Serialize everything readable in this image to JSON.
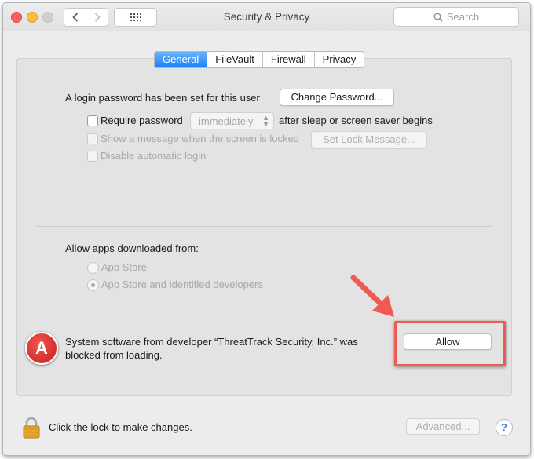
{
  "window": {
    "title": "Security & Privacy"
  },
  "toolbar": {
    "search_placeholder": "Search",
    "back_icon": "chevron-left-icon",
    "forward_icon": "chevron-right-icon",
    "grid_icon": "grid-icon"
  },
  "tabs": [
    {
      "label": "General",
      "active": true
    },
    {
      "label": "FileVault",
      "active": false
    },
    {
      "label": "Firewall",
      "active": false
    },
    {
      "label": "Privacy",
      "active": false
    }
  ],
  "general": {
    "login_password_text": "A login password has been set for this user",
    "change_password_button": "Change Password...",
    "require_password_label": "Require password",
    "require_password_value": "immediately",
    "after_sleep_text": "after sleep or screen saver begins",
    "show_message_label": "Show a message when the screen is locked",
    "set_lock_message_button": "Set Lock Message...",
    "disable_auto_login_label": "Disable automatic login"
  },
  "apps": {
    "heading": "Allow apps downloaded from:",
    "option_app_store": "App Store",
    "option_identified": "App Store and identified developers",
    "selected": "App Store and identified developers"
  },
  "blocked": {
    "badge_letter": "A",
    "message_line1": "System software from developer “ThreatTrack Security, Inc.” was",
    "message_line2": "blocked from loading.",
    "allow_button": "Allow"
  },
  "footer": {
    "lock_text": "Click the lock to make changes.",
    "advanced_button": "Advanced...",
    "help_label": "?"
  },
  "colors": {
    "accent_tab": "#1a82fb",
    "annotation_red": "#ef5a52",
    "badge_red": "#d9332b"
  }
}
